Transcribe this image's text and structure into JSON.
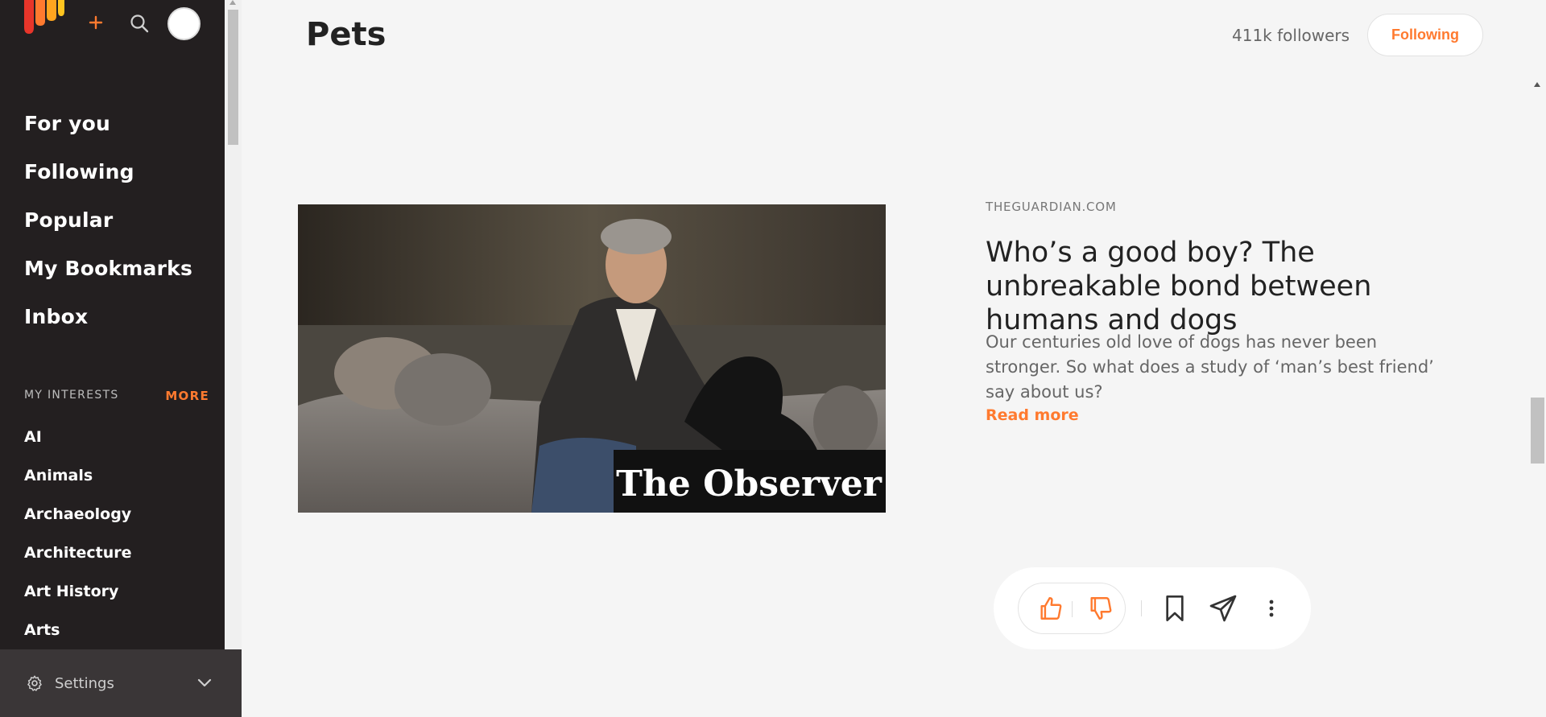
{
  "sidebar": {
    "nav": [
      {
        "label": "For you"
      },
      {
        "label": "Following"
      },
      {
        "label": "Popular"
      },
      {
        "label": "My Bookmarks"
      },
      {
        "label": "Inbox"
      }
    ],
    "interests_label": "MY INTERESTS",
    "interests_more": "MORE",
    "interests": [
      {
        "label": "AI"
      },
      {
        "label": "Animals"
      },
      {
        "label": "Archaeology"
      },
      {
        "label": "Architecture"
      },
      {
        "label": "Art History"
      },
      {
        "label": "Arts"
      }
    ],
    "settings_label": "Settings",
    "icons": {
      "logo": "logo-icon",
      "plus": "plus-icon",
      "search": "search-icon",
      "avatar": "avatar",
      "settings": "gear-icon",
      "expand": "chevron-down-icon"
    }
  },
  "topic": {
    "title": "Pets",
    "followers": "411k followers",
    "follow_button": "Following"
  },
  "article": {
    "source": "THEGUARDIAN.COM",
    "headline": "Who’s a good boy? The unbreakable bond between humans and dogs",
    "summary": "Our centuries old love of dogs has never been stronger. So what does a study of ‘man’s best friend’ say about us?",
    "read_more": "Read more",
    "image_overlay": "The Observer"
  },
  "actions": {
    "icons": [
      "thumbs-up-icon",
      "thumbs-down-icon",
      "bookmark-icon",
      "send-icon",
      "more-vertical-icon"
    ]
  },
  "colors": {
    "accent": "#ff7a2f",
    "sidebar_bg": "#231f20",
    "page_bg": "#f5f5f5"
  }
}
